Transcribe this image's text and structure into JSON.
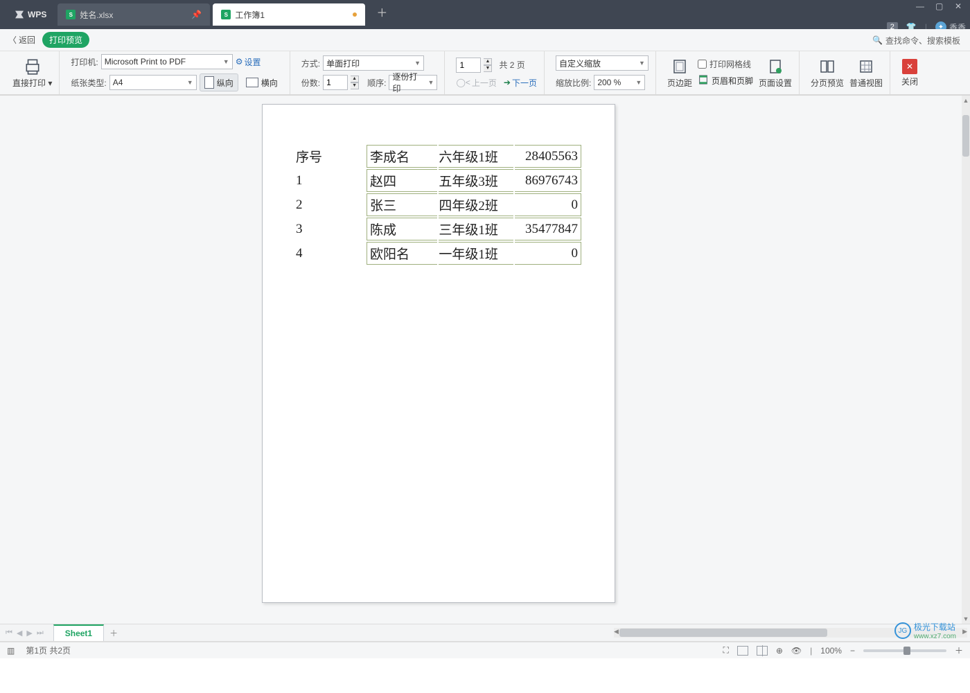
{
  "app": {
    "name": "WPS"
  },
  "window_buttons": {
    "min": "—",
    "max": "▢",
    "close": "✕"
  },
  "topright": {
    "badge": "2",
    "user_name": "香香"
  },
  "tabs": [
    {
      "label": "姓名.xlsx",
      "active": false
    },
    {
      "label": "工作簿1",
      "active": true
    }
  ],
  "subbar": {
    "back": "返回",
    "pill": "打印预览",
    "search_placeholder": "查找命令、搜索模板"
  },
  "ribbon": {
    "direct_print": "直接打印",
    "printer_label": "打印机:",
    "printer_value": "Microsoft Print to PDF",
    "settings": "设置",
    "paper_label": "纸张类型:",
    "paper_value": "A4",
    "orient_portrait": "纵向",
    "orient_landscape": "横向",
    "mode_label": "方式:",
    "mode_value": "单面打印",
    "copies_label": "份数:",
    "copies_value": "1",
    "order_label": "顺序:",
    "order_value": "逐份打印",
    "page_field_value": "1",
    "total_pages_text": "共 2 页",
    "prev_page": "上一页",
    "next_page": "下一页",
    "zoom_mode_value": "自定义缩放",
    "zoom_ratio_label": "缩放比例:",
    "zoom_ratio_value": "200 %",
    "margins": "页边距",
    "grid_chk": "打印网格线",
    "header_footer": "页眉和页脚",
    "page_setup": "页面设置",
    "page_break_preview": "分页预览",
    "normal_view": "普通视图",
    "close": "关闭"
  },
  "preview_table": {
    "rows": [
      {
        "seq": "序号",
        "name": "李成名",
        "cls": "六年级1班",
        "num": "28405563"
      },
      {
        "seq": "1",
        "name": "赵四",
        "cls": "五年级3班",
        "num": "86976743"
      },
      {
        "seq": "2",
        "name": "张三",
        "cls": "四年级2班",
        "num": "0"
      },
      {
        "seq": "3",
        "name": "陈成",
        "cls": "三年级1班",
        "num": "35477847"
      },
      {
        "seq": "4",
        "name": "欧阳名",
        "cls": "一年级1班",
        "num": "0"
      }
    ]
  },
  "sheets": {
    "active": "Sheet1"
  },
  "watermark": {
    "line1": "极光下载站",
    "line2": "www.xz7.com"
  },
  "status": {
    "page_text": "第1页 共2页",
    "zoom_text": "100%"
  }
}
